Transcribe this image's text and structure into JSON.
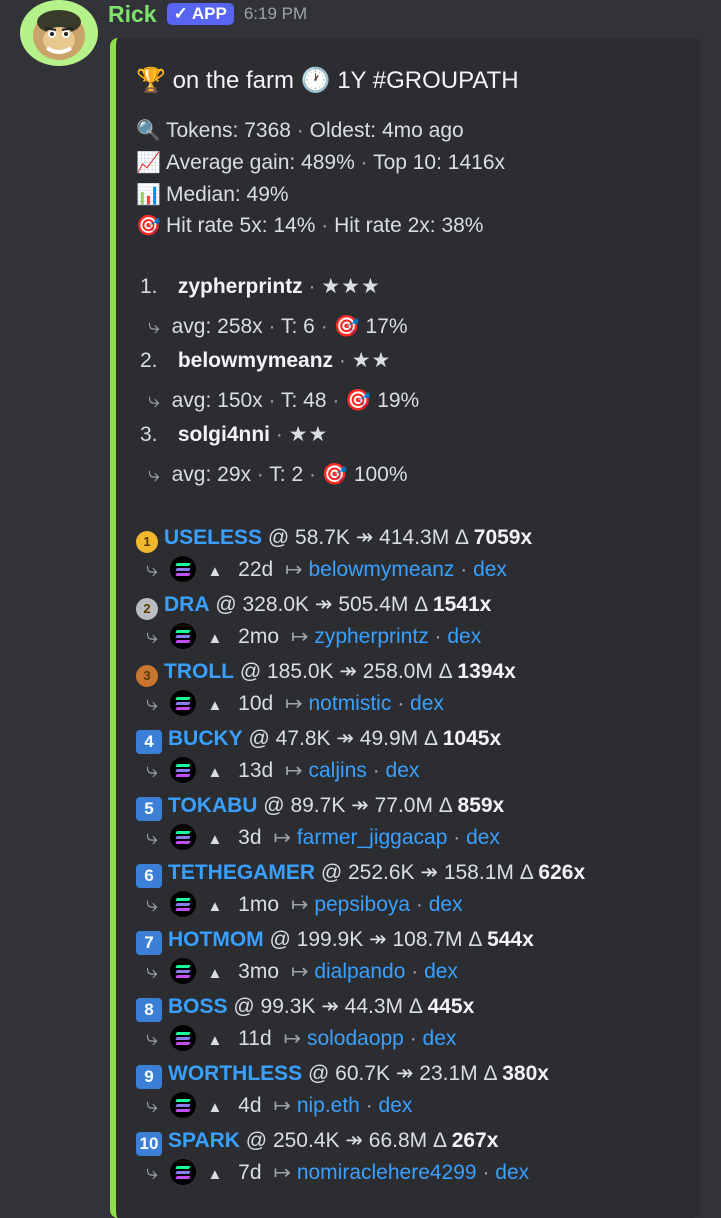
{
  "header": {
    "username": "Rick",
    "badge": "APP",
    "badge_check": "✓",
    "timestamp": "6:19 PM"
  },
  "embed": {
    "title_icon": "trophy-icon",
    "title_text": "on the farm",
    "title_clock": "clock-icon",
    "title_suffix": "1Y #GROUPATH",
    "accent_color": "#8fe04a",
    "stats": {
      "tokens": "Tokens: 7368",
      "oldest": "Oldest: 4mo ago",
      "avg_gain": "Average gain: 489%",
      "top10": "Top 10: 1416x",
      "median": "Median: 49%",
      "hit5": "Hit rate 5x: 14%",
      "hit2": "Hit rate 2x: 38%"
    },
    "leaders": [
      {
        "rank": "1.",
        "name": "zypherprintz",
        "stars": "★★★",
        "avg": "avg: 258x",
        "t": "T: 6",
        "hit": "17%"
      },
      {
        "rank": "2.",
        "name": "belowmymeanz",
        "stars": "★★",
        "avg": "avg: 150x",
        "t": "T: 48",
        "hit": "19%"
      },
      {
        "rank": "3.",
        "name": "solgi4nni",
        "stars": "★★",
        "avg": "avg: 29x",
        "t": "T: 2",
        "hit": "100%"
      }
    ],
    "tokens": [
      {
        "badge": "1",
        "name": "USELESS",
        "range": "@ 58.7K ↠ 414.3M Δ",
        "mult": "7059x",
        "age": "22d",
        "caller": "belowmymeanz",
        "dex": "dex"
      },
      {
        "badge": "2",
        "name": "DRA",
        "range": "@ 328.0K ↠ 505.4M Δ",
        "mult": "1541x",
        "age": "2mo",
        "caller": "zypherprintz",
        "dex": "dex"
      },
      {
        "badge": "3",
        "name": "TROLL",
        "range": "@ 185.0K ↠ 258.0M Δ",
        "mult": "1394x",
        "age": "10d",
        "caller": "notmistic",
        "dex": "dex"
      },
      {
        "badge": "4",
        "name": "BUCKY",
        "range": "@ 47.8K ↠ 49.9M Δ",
        "mult": "1045x",
        "age": "13d",
        "caller": "caljins",
        "dex": "dex"
      },
      {
        "badge": "5",
        "name": "TOKABU",
        "range": "@ 89.7K ↠ 77.0M Δ",
        "mult": "859x",
        "age": "3d",
        "caller": "farmer_jiggacap",
        "dex": "dex"
      },
      {
        "badge": "6",
        "name": "TETHEGAMER",
        "range": "@ 252.6K ↠ 158.1M Δ",
        "mult": "626x",
        "age": "1mo",
        "caller": "pepsiboya",
        "dex": "dex"
      },
      {
        "badge": "7",
        "name": "HOTMOM",
        "range": "@ 199.9K ↠ 108.7M Δ",
        "mult": "544x",
        "age": "3mo",
        "caller": "dialpando",
        "dex": "dex"
      },
      {
        "badge": "8",
        "name": "BOSS",
        "range": "@ 99.3K ↠ 44.3M Δ",
        "mult": "445x",
        "age": "11d",
        "caller": "solodaopp",
        "dex": "dex"
      },
      {
        "badge": "9",
        "name": "WORTHLESS",
        "range": "@ 60.7K ↠ 23.1M Δ",
        "mult": "380x",
        "age": "4d",
        "caller": "nip.eth",
        "dex": "dex"
      },
      {
        "badge": "10",
        "name": "SPARK",
        "range": "@ 250.4K ↠ 66.8M Δ",
        "mult": "267x",
        "age": "7d",
        "caller": "nomiraclehere4299",
        "dex": "dex"
      }
    ]
  }
}
